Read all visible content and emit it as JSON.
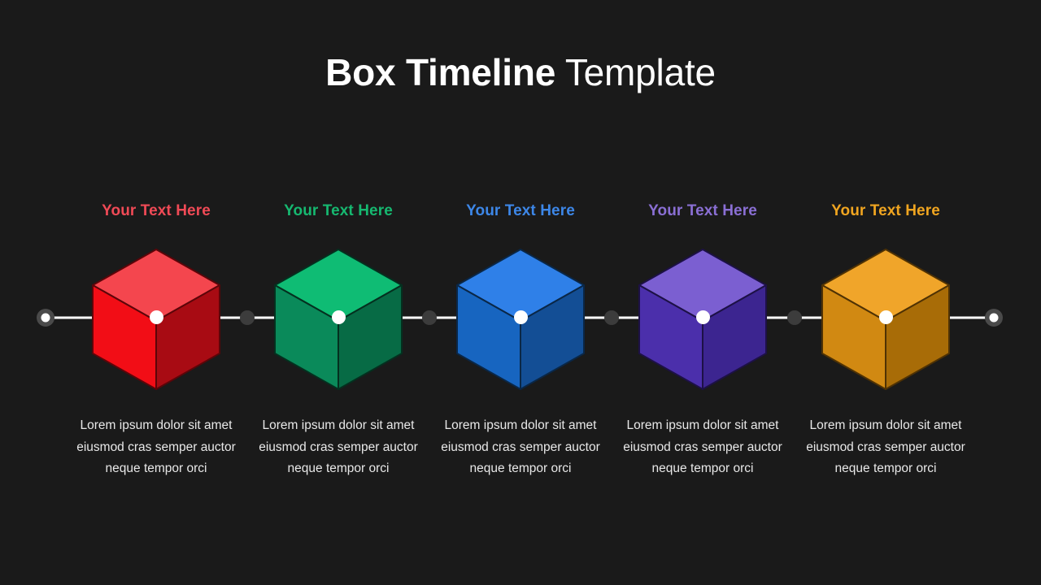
{
  "background_color": "#1a1a1a",
  "title": {
    "bold_part": "Box Timeline",
    "light_part": " Template",
    "color": "#ffffff"
  },
  "timeline": {
    "line_color": "#ffffff",
    "endpoint_ring_color": "#4a4a4a",
    "endpoint_center_color": "#ffffff",
    "midpoint_dot_color": "#3c3c3c",
    "vertex_dot_color": "#ffffff"
  },
  "steps": [
    {
      "label": "Your Text Here",
      "label_color": "#f04a56",
      "body": "Lorem ipsum dolor sit amet eiusmod cras semper auctor neque tempor orci",
      "cube": {
        "top_color": "#f4464e",
        "left_color": "#f20d16",
        "right_color": "#a80b13",
        "edge_color": "#5c0509"
      }
    },
    {
      "label": "Your Text Here",
      "label_color": "#16b870",
      "body": "Lorem ipsum dolor sit amet eiusmod cras semper auctor neque tempor orci",
      "cube": {
        "top_color": "#0fbc74",
        "left_color": "#0a8a5a",
        "right_color": "#076b45",
        "edge_color": "#04301f"
      }
    },
    {
      "label": "Your Text Here",
      "label_color": "#3d87e8",
      "body": "Lorem ipsum dolor sit amet eiusmod cras semper auctor neque tempor orci",
      "cube": {
        "top_color": "#2f80e8",
        "left_color": "#1765c0",
        "right_color": "#134e95",
        "edge_color": "#0a2747"
      }
    },
    {
      "label": "Your Text Here",
      "label_color": "#8a6fd4",
      "body": "Lorem ipsum dolor sit amet eiusmod cras semper auctor neque tempor orci",
      "cube": {
        "top_color": "#7b5fd1",
        "left_color": "#4b2fab",
        "right_color": "#3c2590",
        "edge_color": "#1d1146"
      }
    },
    {
      "label": "Your Text Here",
      "label_color": "#f0a520",
      "body": "Lorem ipsum dolor sit amet eiusmod cras semper auctor neque tempor orci",
      "cube": {
        "top_color": "#f0a52a",
        "left_color": "#d18912",
        "right_color": "#a86c07",
        "edge_color": "#4f3204"
      }
    }
  ]
}
